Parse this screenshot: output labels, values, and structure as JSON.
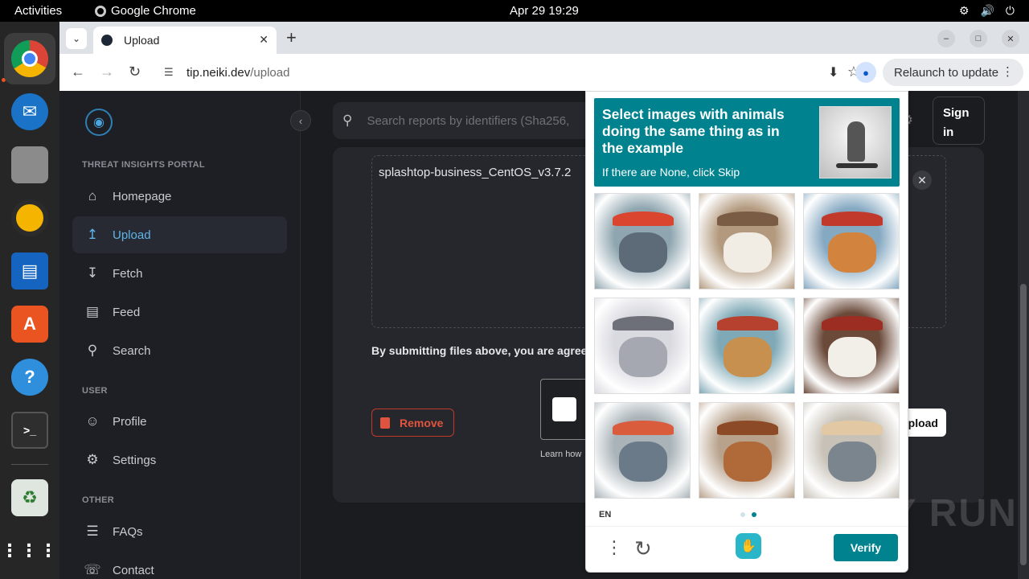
{
  "topbar": {
    "activities": "Activities",
    "app_name": "Google Chrome",
    "clock": "Apr 29  19:29"
  },
  "dock": {
    "items": [
      "chrome-icon",
      "thunderbird-icon",
      "files-icon",
      "rhythmbox-icon",
      "writer-icon",
      "app-center-icon",
      "help-icon",
      "terminal-icon",
      "trash-icon",
      "app-grid-icon"
    ]
  },
  "browser": {
    "tab_title": "Upload",
    "url_host": "tip.neiki.dev",
    "url_path": "/upload",
    "relaunch_label": "Relaunch to update"
  },
  "sidebar": {
    "section_portal": "THREAT INSIGHTS PORTAL",
    "section_user": "USER",
    "section_other": "OTHER",
    "items": [
      {
        "label": "Homepage",
        "icon": "home-icon"
      },
      {
        "label": "Upload",
        "icon": "upload-icon"
      },
      {
        "label": "Fetch",
        "icon": "fetch-icon"
      },
      {
        "label": "Feed",
        "icon": "feed-icon"
      },
      {
        "label": "Search",
        "icon": "search-icon"
      },
      {
        "label": "Profile",
        "icon": "profile-icon"
      },
      {
        "label": "Settings",
        "icon": "gear-icon"
      },
      {
        "label": "FAQs",
        "icon": "faq-icon"
      },
      {
        "label": "Contact",
        "icon": "contact-icon"
      }
    ]
  },
  "main": {
    "search_placeholder": "Search reports by identifiers (Sha256,",
    "signin_label": "Sign in",
    "filename": "splashtop-business_CentOS_v3.7.2",
    "terms_text": "By submitting files above, you are agreei",
    "remove_label": "Remove",
    "learn_text": "Learn how",
    "upload_label": "pload"
  },
  "captcha": {
    "title": "Select images with animals doing the same thing as in the example",
    "subtitle": "If there are None, click Skip",
    "lang": "EN",
    "verify_label": "Verify",
    "tiles": [
      {
        "subject": "elephant with umbrella",
        "bg": "#8fa6b0",
        "subj": "#5d6b78",
        "prop": "#d9452f"
      },
      {
        "subject": "chickens",
        "bg": "#b39a7e",
        "subj": "#f1ece4",
        "prop": "#7a5c44"
      },
      {
        "subject": "dog on skateboard",
        "bg": "#86a9c2",
        "subj": "#d2843f",
        "prop": "#c0392b"
      },
      {
        "subject": "toy car",
        "bg": "#d9d9e0",
        "subj": "#a5a8b0",
        "prop": "#6d7078"
      },
      {
        "subject": "dog on skateboard",
        "bg": "#7fa9b6",
        "subj": "#c7904f",
        "prop": "#b7412f"
      },
      {
        "subject": "chickens",
        "bg": "#6b4a3a",
        "subj": "#f2eee8",
        "prop": "#9b2d22"
      },
      {
        "subject": "elephant with umbrella",
        "bg": "#a9b3b8",
        "subj": "#6b7a88",
        "prop": "#d95c3d"
      },
      {
        "subject": "hens",
        "bg": "#b8a28c",
        "subj": "#b06a3a",
        "prop": "#8d4a26"
      },
      {
        "subject": "elephant with umbrella",
        "bg": "#c7c1b7",
        "subj": "#7b858e",
        "prop": "#e2c9a4"
      }
    ]
  },
  "watermark": "ANY RUN",
  "colors": {
    "accent": "#5fb4ea",
    "captcha_teal": "#00838f",
    "danger": "#e0543f"
  }
}
